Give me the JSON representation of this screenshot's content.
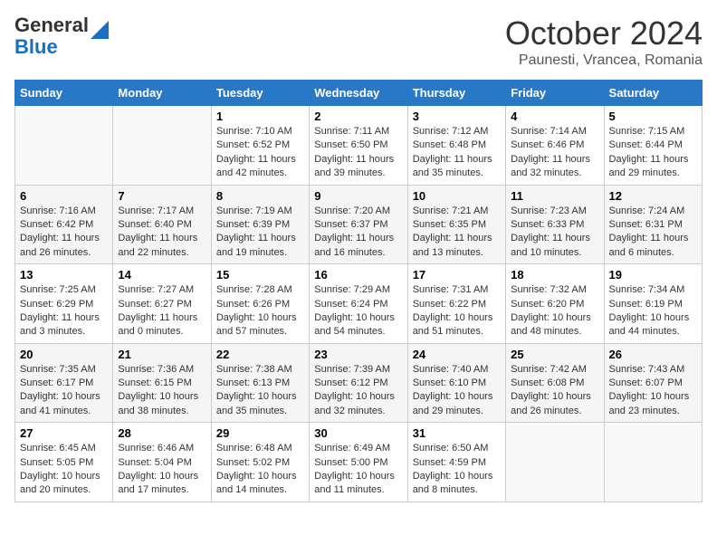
{
  "header": {
    "logo_general": "General",
    "logo_blue": "Blue",
    "title": "October 2024",
    "subtitle": "Paunesti, Vrancea, Romania"
  },
  "days_of_week": [
    "Sunday",
    "Monday",
    "Tuesday",
    "Wednesday",
    "Thursday",
    "Friday",
    "Saturday"
  ],
  "weeks": [
    [
      {
        "day": "",
        "info": ""
      },
      {
        "day": "",
        "info": ""
      },
      {
        "day": "1",
        "info": "Sunrise: 7:10 AM\nSunset: 6:52 PM\nDaylight: 11 hours and 42 minutes."
      },
      {
        "day": "2",
        "info": "Sunrise: 7:11 AM\nSunset: 6:50 PM\nDaylight: 11 hours and 39 minutes."
      },
      {
        "day": "3",
        "info": "Sunrise: 7:12 AM\nSunset: 6:48 PM\nDaylight: 11 hours and 35 minutes."
      },
      {
        "day": "4",
        "info": "Sunrise: 7:14 AM\nSunset: 6:46 PM\nDaylight: 11 hours and 32 minutes."
      },
      {
        "day": "5",
        "info": "Sunrise: 7:15 AM\nSunset: 6:44 PM\nDaylight: 11 hours and 29 minutes."
      }
    ],
    [
      {
        "day": "6",
        "info": "Sunrise: 7:16 AM\nSunset: 6:42 PM\nDaylight: 11 hours and 26 minutes."
      },
      {
        "day": "7",
        "info": "Sunrise: 7:17 AM\nSunset: 6:40 PM\nDaylight: 11 hours and 22 minutes."
      },
      {
        "day": "8",
        "info": "Sunrise: 7:19 AM\nSunset: 6:39 PM\nDaylight: 11 hours and 19 minutes."
      },
      {
        "day": "9",
        "info": "Sunrise: 7:20 AM\nSunset: 6:37 PM\nDaylight: 11 hours and 16 minutes."
      },
      {
        "day": "10",
        "info": "Sunrise: 7:21 AM\nSunset: 6:35 PM\nDaylight: 11 hours and 13 minutes."
      },
      {
        "day": "11",
        "info": "Sunrise: 7:23 AM\nSunset: 6:33 PM\nDaylight: 11 hours and 10 minutes."
      },
      {
        "day": "12",
        "info": "Sunrise: 7:24 AM\nSunset: 6:31 PM\nDaylight: 11 hours and 6 minutes."
      }
    ],
    [
      {
        "day": "13",
        "info": "Sunrise: 7:25 AM\nSunset: 6:29 PM\nDaylight: 11 hours and 3 minutes."
      },
      {
        "day": "14",
        "info": "Sunrise: 7:27 AM\nSunset: 6:27 PM\nDaylight: 11 hours and 0 minutes."
      },
      {
        "day": "15",
        "info": "Sunrise: 7:28 AM\nSunset: 6:26 PM\nDaylight: 10 hours and 57 minutes."
      },
      {
        "day": "16",
        "info": "Sunrise: 7:29 AM\nSunset: 6:24 PM\nDaylight: 10 hours and 54 minutes."
      },
      {
        "day": "17",
        "info": "Sunrise: 7:31 AM\nSunset: 6:22 PM\nDaylight: 10 hours and 51 minutes."
      },
      {
        "day": "18",
        "info": "Sunrise: 7:32 AM\nSunset: 6:20 PM\nDaylight: 10 hours and 48 minutes."
      },
      {
        "day": "19",
        "info": "Sunrise: 7:34 AM\nSunset: 6:19 PM\nDaylight: 10 hours and 44 minutes."
      }
    ],
    [
      {
        "day": "20",
        "info": "Sunrise: 7:35 AM\nSunset: 6:17 PM\nDaylight: 10 hours and 41 minutes."
      },
      {
        "day": "21",
        "info": "Sunrise: 7:36 AM\nSunset: 6:15 PM\nDaylight: 10 hours and 38 minutes."
      },
      {
        "day": "22",
        "info": "Sunrise: 7:38 AM\nSunset: 6:13 PM\nDaylight: 10 hours and 35 minutes."
      },
      {
        "day": "23",
        "info": "Sunrise: 7:39 AM\nSunset: 6:12 PM\nDaylight: 10 hours and 32 minutes."
      },
      {
        "day": "24",
        "info": "Sunrise: 7:40 AM\nSunset: 6:10 PM\nDaylight: 10 hours and 29 minutes."
      },
      {
        "day": "25",
        "info": "Sunrise: 7:42 AM\nSunset: 6:08 PM\nDaylight: 10 hours and 26 minutes."
      },
      {
        "day": "26",
        "info": "Sunrise: 7:43 AM\nSunset: 6:07 PM\nDaylight: 10 hours and 23 minutes."
      }
    ],
    [
      {
        "day": "27",
        "info": "Sunrise: 6:45 AM\nSunset: 5:05 PM\nDaylight: 10 hours and 20 minutes."
      },
      {
        "day": "28",
        "info": "Sunrise: 6:46 AM\nSunset: 5:04 PM\nDaylight: 10 hours and 17 minutes."
      },
      {
        "day": "29",
        "info": "Sunrise: 6:48 AM\nSunset: 5:02 PM\nDaylight: 10 hours and 14 minutes."
      },
      {
        "day": "30",
        "info": "Sunrise: 6:49 AM\nSunset: 5:00 PM\nDaylight: 10 hours and 11 minutes."
      },
      {
        "day": "31",
        "info": "Sunrise: 6:50 AM\nSunset: 4:59 PM\nDaylight: 10 hours and 8 minutes."
      },
      {
        "day": "",
        "info": ""
      },
      {
        "day": "",
        "info": ""
      }
    ]
  ]
}
